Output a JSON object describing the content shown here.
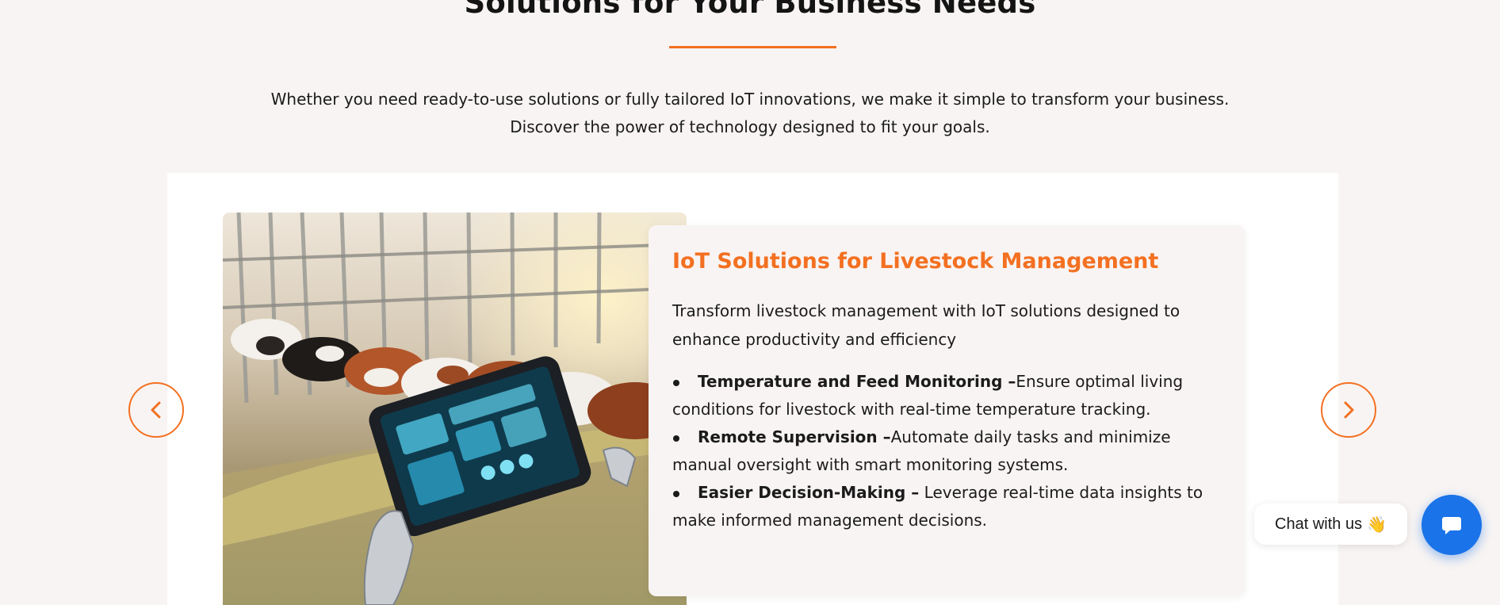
{
  "section": {
    "title": "Solutions for Your Business Needs",
    "intro": "Whether you need ready-to-use solutions or fully tailored IoT innovations, we make it simple to transform your business. Discover the power of technology designed to fit your goals."
  },
  "slide": {
    "image_alt": "Cows at a feeding stall with a robotic hand holding a tablet",
    "title": "IoT Solutions for Livestock Management",
    "description": "Transform livestock management with IoT solutions designed to enhance productivity and efficiency",
    "features": [
      {
        "title": "Temperature and Feed Monitoring –",
        "text": "Ensure optimal living conditions for livestock with real-time temperature tracking."
      },
      {
        "title": "Remote Supervision –",
        "text": "Automate daily tasks and minimize manual oversight with smart monitoring systems."
      },
      {
        "title": "Easier Decision-Making –",
        "text": " Leverage real-time data insights to make informed management decisions."
      }
    ]
  },
  "carousel": {
    "prev_icon": "chevron-left-icon",
    "next_icon": "chevron-right-icon"
  },
  "chat": {
    "label": "Chat with us",
    "emoji": "👋",
    "icon": "chat-bubble-icon"
  },
  "colors": {
    "accent": "#f37021",
    "background": "#f8f4f3",
    "chat_blue": "#1a73e8"
  }
}
